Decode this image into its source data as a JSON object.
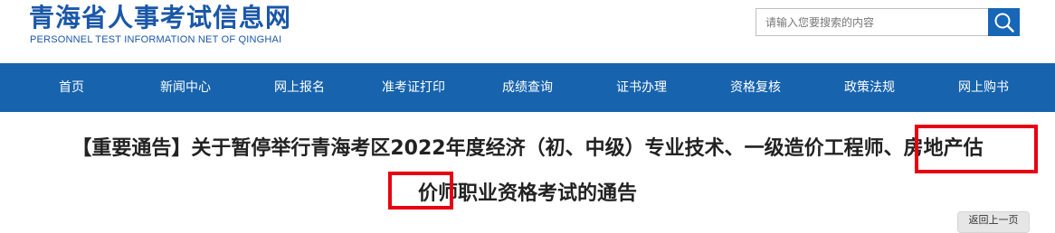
{
  "header": {
    "site_title": "青海省人事考试信息网",
    "site_subtitle": "PERSONNEL TEST INFORMATION NET OF QINGHAI"
  },
  "search": {
    "placeholder": "请输入您要搜索的内容",
    "icon": "search-icon"
  },
  "nav": {
    "items": [
      {
        "label": "首页"
      },
      {
        "label": "新闻中心"
      },
      {
        "label": "网上报名"
      },
      {
        "label": "准考证打印"
      },
      {
        "label": "成绩查询"
      },
      {
        "label": "证书办理"
      },
      {
        "label": "资格复核"
      },
      {
        "label": "政策法规"
      },
      {
        "label": "网上购书"
      }
    ]
  },
  "article": {
    "title_line1": "【重要通告】关于暂停举行青海考区2022年度经济（初、中级）专业技术、一级造价工程师、房地产估",
    "title_line2": "价师职业资格考试的通告"
  },
  "back": {
    "label": "返回上一页"
  },
  "colors": {
    "brand_blue": "#1a57a8",
    "nav_blue": "#1763ad",
    "search_button": "#1766b8",
    "highlight_red": "#e60012"
  }
}
